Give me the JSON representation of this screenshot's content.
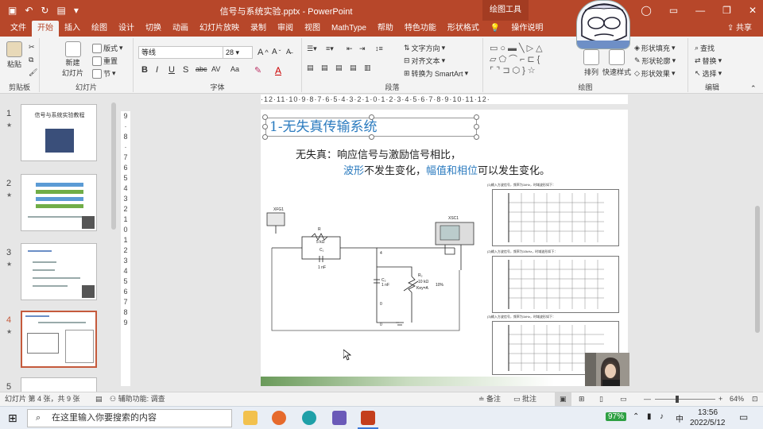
{
  "app": {
    "title": "信号与系统实验.pptx - PowerPoint",
    "context_tab": "绘图工具",
    "qat": {
      "autosave_icon": "save-icon",
      "undo_icon": "undo-icon",
      "redo_icon": "redo-icon"
    }
  },
  "menu": {
    "tabs": [
      "文件",
      "开始",
      "插入",
      "绘图",
      "设计",
      "切换",
      "动画",
      "幻灯片放映",
      "录制",
      "审阅",
      "视图",
      "MathType",
      "帮助",
      "特色功能",
      "形状格式"
    ],
    "active": "开始",
    "search": "操作说明",
    "share": "共享"
  },
  "ribbon": {
    "clipboard": {
      "paste": "粘贴",
      "label": "剪贴板"
    },
    "slides": {
      "new_slide": "新建",
      "new_slide2": "幻灯片",
      "layout": "版式",
      "reset": "重置",
      "section": "节",
      "label": "幻灯片"
    },
    "font": {
      "name": "等线",
      "size": "28",
      "bold": "B",
      "italic": "I",
      "underline": "U",
      "strike": "S",
      "abc": "abc",
      "spacing": "AV",
      "case": "Aa",
      "color": "A",
      "label": "字体"
    },
    "paragraph": {
      "text_direction": "文字方向",
      "align_text": "对齐文本",
      "smartart": "转换为 SmartArt",
      "label": "段落"
    },
    "drawing": {
      "arrange": "排列",
      "quick_styles": "快速样式",
      "shape_fill": "形状填充",
      "shape_outline": "形状轮廓",
      "shape_effects": "形状效果",
      "label": "绘图"
    },
    "editing": {
      "find": "查找",
      "replace": "替换",
      "select": "选择",
      "label": "编辑"
    }
  },
  "thumbnails": [
    {
      "num": "1",
      "title": "信号与系统实验教程"
    },
    {
      "num": "2",
      "title": ""
    },
    {
      "num": "3",
      "title": ""
    },
    {
      "num": "4",
      "title": "",
      "selected": true
    },
    {
      "num": "5",
      "title": ""
    }
  ],
  "rulers": {
    "horizontal": "·12·11·10·9·8·7·6·5·4·3·2·1·0·1·2·3·4·5·6·7·8·9·10·11·12·",
    "vertical": [
      "9",
      "8",
      "7",
      "6",
      "5",
      "4",
      "3",
      "2",
      "1",
      "0",
      "1",
      "2",
      "3",
      "4",
      "5",
      "6",
      "7",
      "8",
      "9"
    ]
  },
  "slide": {
    "title": "1-无失真传输系统",
    "line1_prefix": "无失真：",
    "line1_rest": "响应信号与激励信号相比，",
    "line2_blue1": "波形",
    "line2_mid": "不发生变化，",
    "line2_blue2": "幅值和相位",
    "line2_end": "可以发生变化。",
    "circuit": {
      "xfg": "XFG1",
      "xsc": "XSC1",
      "r1": "R",
      "r1val": "5 kΩ",
      "c1": "C₁",
      "c1val": "1 nF",
      "c2": "C₂",
      "c2val": "1 nF",
      "r2": "R₂",
      "r2val": "10 kΩ",
      "key": "Key=A",
      "pct": "10%",
      "node4": "4",
      "node0": "0",
      "node0b": "0"
    },
    "graph_captions": [
      "(1)输入方波信号，频率为1kHz，时域波形如下：",
      "(2)输入方波信号，频率为10kHz，时域波形如下：",
      "(3)输入方波信号，频率为1kHz，时域波形如下："
    ]
  },
  "status": {
    "slide_info": "幻灯片 第 4 张，共 9 张",
    "accessibility": "辅助功能: 调查",
    "notes": "备注",
    "comments": "批注",
    "zoom": "64%"
  },
  "taskbar": {
    "search_placeholder": "在这里输入你要搜索的内容",
    "battery": "97%",
    "ime": "中",
    "time": "13:56",
    "date": "2022/5/12"
  }
}
